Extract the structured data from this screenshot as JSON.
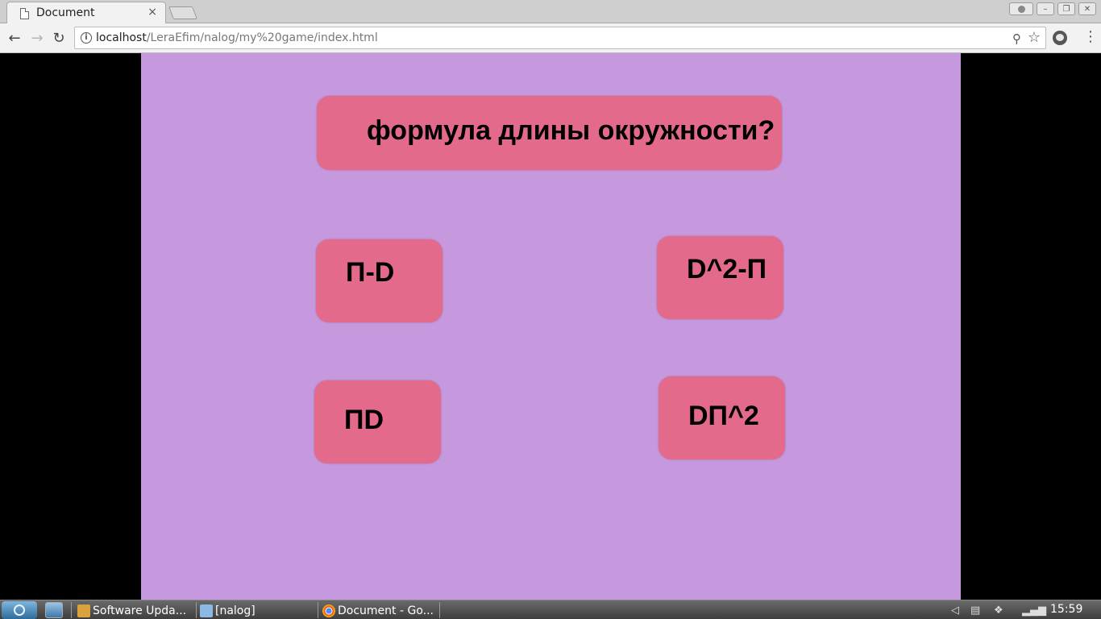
{
  "browser": {
    "tab_title": "Document",
    "tab_close": "×",
    "url_host": "localhost",
    "url_path": "/LeraEfim/nalog/my%20game/index.html"
  },
  "game": {
    "question": "формула длины окружности?",
    "answers": [
      "П-D",
      "D^2-П",
      "ПD",
      "DП^2"
    ],
    "colors": {
      "background": "#c699de",
      "card": "#e36a8b"
    }
  },
  "taskbar": {
    "items": [
      "Software Upda...",
      "[nalog]",
      "Document - Go..."
    ],
    "clock": "15:59"
  }
}
